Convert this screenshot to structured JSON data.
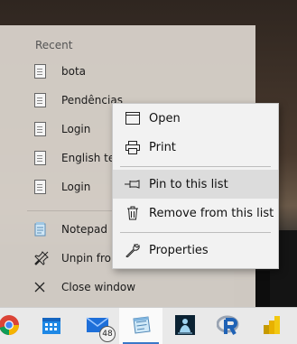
{
  "jumplist": {
    "section_title": "Recent",
    "recent": [
      {
        "label": "bota",
        "icon": "document-icon"
      },
      {
        "label": "Pendências",
        "icon": "document-icon"
      },
      {
        "label": "Login",
        "icon": "document-icon"
      },
      {
        "label": "English ter",
        "icon": "document-icon"
      },
      {
        "label": "Login",
        "icon": "document-icon"
      }
    ],
    "tasks": [
      {
        "label": "Notepad",
        "icon": "notepad-icon"
      },
      {
        "label": "Unpin from",
        "icon": "unpin-icon"
      },
      {
        "label": "Close window",
        "icon": "close-icon"
      }
    ]
  },
  "context_menu": {
    "items": [
      {
        "label": "Open",
        "icon": "window-icon"
      },
      {
        "label": "Print",
        "icon": "printer-icon"
      },
      {
        "label": "Pin to this list",
        "icon": "pin-icon",
        "hovered": true
      },
      {
        "label": "Remove from this list",
        "icon": "trash-icon"
      },
      {
        "label": "Properties",
        "icon": "wrench-icon"
      }
    ]
  },
  "taskbar": {
    "apps": [
      {
        "name": "chrome-icon"
      },
      {
        "name": "calendar-icon"
      },
      {
        "name": "mail-icon",
        "badge": "48"
      },
      {
        "name": "notepad-icon",
        "active": true
      },
      {
        "name": "kindle-icon"
      },
      {
        "name": "r-icon"
      },
      {
        "name": "powerbi-icon"
      }
    ]
  },
  "colors": {
    "panel": "#d6d0c9",
    "menu": "#f2f2f2",
    "hover": "#dcdcdc",
    "taskbar": "#e9e9e9",
    "accent": "#3a78c8"
  }
}
